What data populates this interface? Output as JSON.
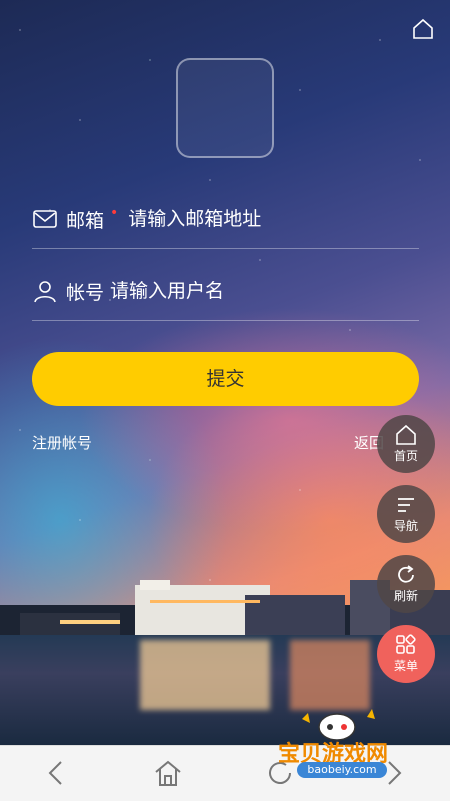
{
  "form": {
    "email_label": "邮箱",
    "email_required_mark": "•",
    "email_placeholder": "请输入邮箱地址",
    "account_label": "帐号",
    "account_placeholder": "请输入用户名",
    "submit_label": "提交",
    "register_link": "注册帐号",
    "back_link": "返回"
  },
  "float_menu": {
    "home": "首页",
    "nav": "导航",
    "refresh": "刷新",
    "menu": "菜单"
  },
  "watermark": {
    "text": "宝贝游戏网",
    "url": "baobeiy.com"
  },
  "colors": {
    "submit": "#ffcc00",
    "menu_button": "#f0625c",
    "fab": "#504646"
  }
}
